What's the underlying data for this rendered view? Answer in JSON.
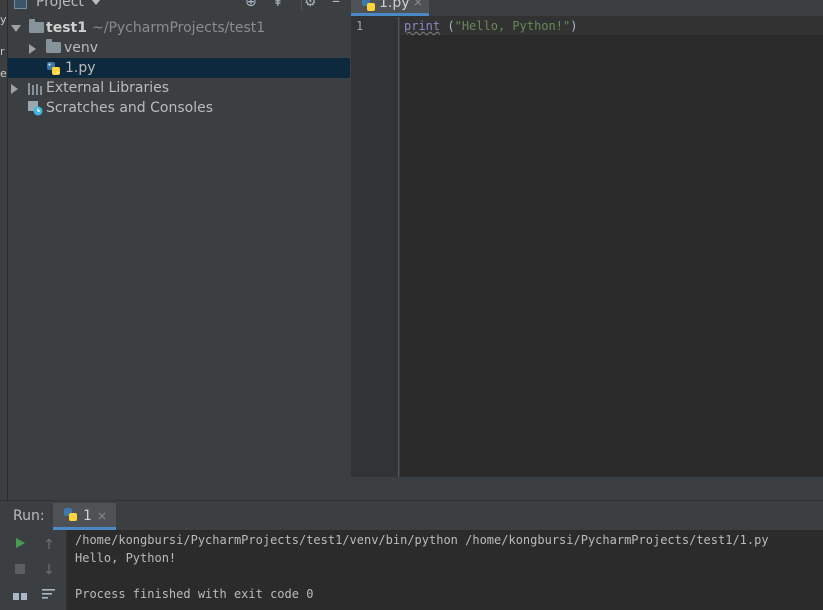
{
  "left_strip": {
    "chars": [
      "y",
      "r",
      "e"
    ]
  },
  "project_panel": {
    "title": "Project",
    "tree": {
      "root": {
        "name": "test1",
        "path": "~/PycharmProjects/test1"
      },
      "venv": "venv",
      "file": "1.py",
      "external_libraries": "External Libraries",
      "scratches": "Scratches and Consoles"
    }
  },
  "editor": {
    "tab_label": "1.py",
    "tab_close": "×",
    "line_number": "1",
    "code": {
      "func": "print",
      "space": " ",
      "open": "(",
      "str": "\"Hello, Python!\"",
      "close": ")"
    }
  },
  "run": {
    "label": "Run:",
    "tab_label": "1",
    "tab_close": "×",
    "console": [
      "/home/kongbursi/PycharmProjects/test1/venv/bin/python /home/kongbursi/PycharmProjects/test1/1.py",
      "Hello, Python!",
      "",
      "Process finished with exit code 0"
    ]
  },
  "colors": {
    "accent": "#4a88c7",
    "selection": "#0d293e",
    "run_green": "#499c54"
  }
}
